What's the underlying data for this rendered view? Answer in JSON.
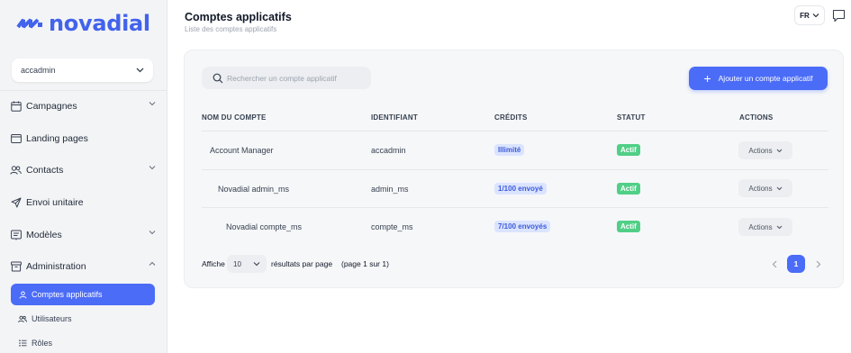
{
  "brand": {
    "name": "novadial",
    "color": "#4263eb"
  },
  "sidebar": {
    "account_select": {
      "value": "accadmin"
    },
    "items": [
      {
        "label": "Campagnes",
        "icon": "calendar-icon",
        "has_chevron": true,
        "chevron": "down"
      },
      {
        "label": "Landing pages",
        "icon": "browser-icon",
        "has_chevron": false
      },
      {
        "label": "Contacts",
        "icon": "users-icon",
        "has_chevron": true,
        "chevron": "down"
      },
      {
        "label": "Envoi unitaire",
        "icon": "send-icon",
        "has_chevron": false
      },
      {
        "label": "Modèles",
        "icon": "template-icon",
        "has_chevron": true,
        "chevron": "down"
      },
      {
        "label": "Administration",
        "icon": "archive-icon",
        "has_chevron": true,
        "chevron": "up"
      }
    ],
    "subitems": [
      {
        "label": "Comptes applicatifs",
        "icon": "user-icon",
        "active": true
      },
      {
        "label": "Utilisateurs",
        "icon": "users-icon",
        "active": false
      },
      {
        "label": "Rôles",
        "icon": "list-icon",
        "active": false
      }
    ]
  },
  "header": {
    "title": "Comptes applicatifs",
    "subtitle": "Liste des comptes applicatifs",
    "language": "FR"
  },
  "toolbar": {
    "search_placeholder": "Rechercher un compte applicatif",
    "add_label": "Ajouter un compte applicatif"
  },
  "table": {
    "columns": [
      "NOM DU COMPTE",
      "IDENTIFIANT",
      "CRÉDITS",
      "STATUT",
      "ACTIONS"
    ],
    "rows": [
      {
        "name": "Account Manager",
        "indent": 0,
        "identifier": "accadmin",
        "credits": "Illimité",
        "status": "Actif",
        "actions": "Actions"
      },
      {
        "name": "Novadial admin_ms",
        "indent": 1,
        "identifier": "admin_ms",
        "credits": "1/100 envoyé",
        "status": "Actif",
        "actions": "Actions"
      },
      {
        "name": "Novadial compte_ms",
        "indent": 2,
        "identifier": "compte_ms",
        "credits": "7/100 envoyés",
        "status": "Actif",
        "actions": "Actions"
      }
    ]
  },
  "pagination": {
    "show_label": "Affiche",
    "per_page": "10",
    "per_page_label": "résultats par page",
    "page_info": "(page 1 sur 1)",
    "current_page": "1"
  },
  "colors": {
    "accent": "#4b6cf7",
    "status_active": "#51cf87",
    "credit_badge_bg": "#dbe4ff",
    "credit_badge_text": "#3b5bdb"
  }
}
